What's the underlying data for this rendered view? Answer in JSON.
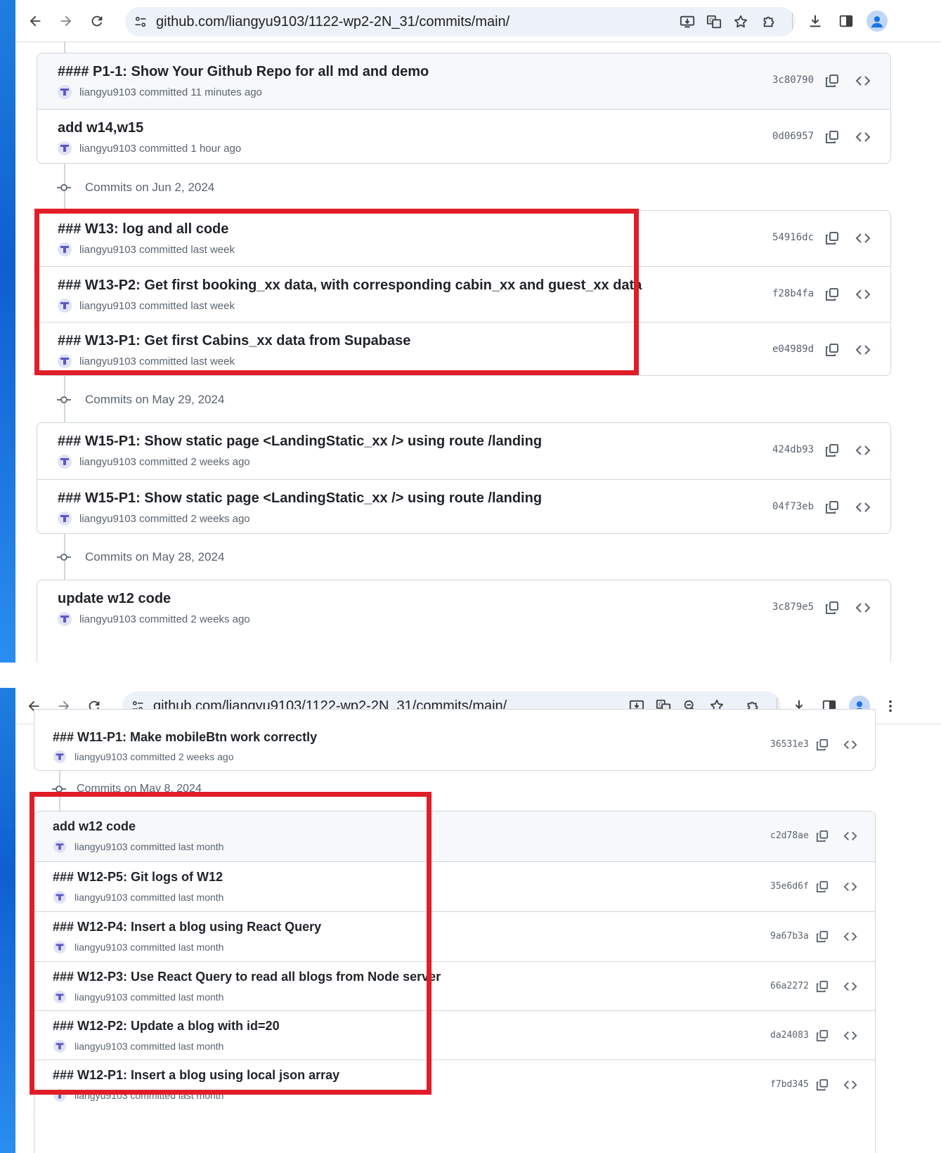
{
  "browser": {
    "url": "github.com/liangyu9103/1122-wp2-2N_31/commits/main/"
  },
  "colors": {
    "highlight_box": "#e11d28",
    "accent": "#0969da"
  },
  "icons": {
    "back": "arrow-left-icon",
    "forward": "arrow-right-icon",
    "reload": "reload-icon",
    "site_info": "tune-icon",
    "install": "install-app-icon",
    "translate": "translate-icon",
    "zoom": "zoom-icon",
    "bookmark": "star-icon",
    "extensions": "puzzle-icon",
    "downloads": "download-icon",
    "side_panel": "side-panel-icon",
    "profile": "profile-icon",
    "menu": "kebab-menu-icon",
    "copy": "copy-icon",
    "browse": "code-icon",
    "commit_node": "git-commit-icon"
  },
  "top": {
    "groups": [
      {
        "date_label": "",
        "commits": [
          {
            "title": "#### P1-1: Show Your Github Repo for all md and demo",
            "author": "liangyu9103",
            "time": "committed 11 minutes ago",
            "sha": "3c80790"
          },
          {
            "title": "add w14,w15",
            "author": "liangyu9103",
            "time": "committed 1 hour ago",
            "sha": "0d06957"
          }
        ]
      },
      {
        "date_label": "Commits on Jun 2, 2024",
        "commits": [
          {
            "title": "### W13: log and all code",
            "author": "liangyu9103",
            "time": "committed last week",
            "sha": "54916dc"
          },
          {
            "title": "### W13-P2: Get first booking_xx data, with corresponding cabin_xx and guest_xx data",
            "author": "liangyu9103",
            "time": "committed last week",
            "sha": "f28b4fa"
          },
          {
            "title": "### W13-P1: Get first Cabins_xx data from Supabase",
            "author": "liangyu9103",
            "time": "committed last week",
            "sha": "e04989d"
          }
        ]
      },
      {
        "date_label": "Commits on May 29, 2024",
        "commits": [
          {
            "title": "### W15-P1: Show static page <LandingStatic_xx /> using route /landing",
            "author": "liangyu9103",
            "time": "committed 2 weeks ago",
            "sha": "424db93"
          },
          {
            "title": "### W15-P1: Show static page <LandingStatic_xx /> using route /landing",
            "author": "liangyu9103",
            "time": "committed 2 weeks ago",
            "sha": "04f73eb"
          }
        ]
      },
      {
        "date_label": "Commits on May 28, 2024",
        "commits": [
          {
            "title": "update w12 code",
            "author": "liangyu9103",
            "time": "committed 2 weeks ago",
            "sha": "3c879e5"
          }
        ]
      }
    ]
  },
  "bottom": {
    "groups": [
      {
        "date_label": "",
        "commits": [
          {
            "title": "### W11-P1: Make mobileBtn work correctly",
            "author": "liangyu9103",
            "time": "committed 2 weeks ago",
            "sha": "36531e3"
          }
        ]
      },
      {
        "date_label": "Commits on May 8, 2024",
        "commits": [
          {
            "title": "add w12 code",
            "author": "liangyu9103",
            "time": "committed last month",
            "sha": "c2d78ae"
          },
          {
            "title": "### W12-P5: Git logs of W12",
            "author": "liangyu9103",
            "time": "committed last month",
            "sha": "35e6d6f"
          },
          {
            "title": "### W12-P4: Insert a blog using React Query",
            "author": "liangyu9103",
            "time": "committed last month",
            "sha": "9a67b3a"
          },
          {
            "title": "### W12-P3: Use React Query to read all blogs from Node server",
            "author": "liangyu9103",
            "time": "committed last month",
            "sha": "66a2272"
          },
          {
            "title": "### W12-P2: Update a blog with id=20",
            "author": "liangyu9103",
            "time": "committed last month",
            "sha": "da24083"
          },
          {
            "title": "### W12-P1: Insert a blog using local json array",
            "author": "liangyu9103",
            "time": "committed last month",
            "sha": "f7bd345"
          }
        ]
      }
    ]
  }
}
